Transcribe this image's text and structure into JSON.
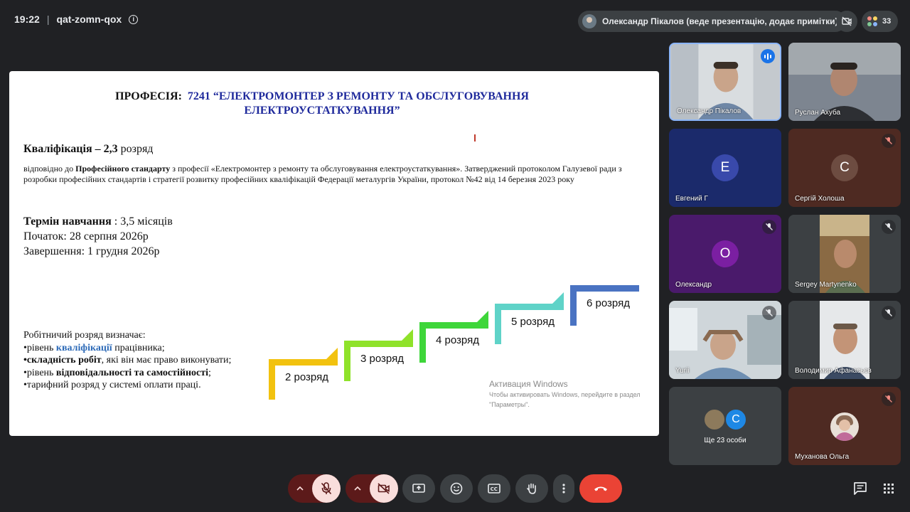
{
  "meeting": {
    "time": "19:22",
    "separator": "|",
    "code": "qat-zomn-qox",
    "presenter_status": "Олександр Пікалов (веде презентацію, додає примітки)",
    "participant_count": "33"
  },
  "slide": {
    "title_prefix": "ПРОФЕСІЯ:",
    "title_line1": "7241 “ЕЛЕКТРОМОНТЕР З РЕМОНТУ ТА ОБСЛУГОВУВАННЯ",
    "title_line2": "ЕЛЕКТРОУСТАТКУВАННЯ”",
    "qualification_bold": "Кваліфікація – 2,3",
    "qualification_rest": "  розряд",
    "description_pre": "відповідно до ",
    "description_bold": "Професійного стандарту",
    "description_post": " з професії  «Електромонтер з ремонту та обслуговування електроустаткування».  Затверджений протоколом Галузевої ради з розробки професійних стандартів і стратегії розвитку професійних кваліфікацій Федерації металургів України, протокол №42 від 14 березня 2023 року",
    "term_bold": "Термін навчання",
    "term_rest": " : 3,5  місяців",
    "start": "Початок: 28 серпня 2026р",
    "end": "Завершення:  1 грудня 2026р",
    "determines_heading": "Робітничий розряд визначає:",
    "bullet1_pre": "•рівень ",
    "bullet1_blue": "кваліфікації",
    "bullet1_post": " працівника;",
    "bullet2_bold": "•складність робіт",
    "bullet2_post": ", які він має право виконувати;",
    "bullet3_pre": "•рівень ",
    "bullet3_bold": "відповідальності та самостійності",
    "bullet3_post": ";",
    "bullet4": "•тарифний розряд у системі оплати праці.",
    "steps": [
      "2  розряд",
      "3  розряд",
      "4  розряд",
      "5  розряд",
      "6  розряд"
    ],
    "step_colors": [
      "#f2c20f",
      "#8fe22a",
      "#3ed63a",
      "#5fd3c8",
      "#4a73c2"
    ],
    "watermark_title": "Активация Windows",
    "watermark_sub1": "Чтобы активировать Windows, перейдите в раздел",
    "watermark_sub2": "\"Параметры\"."
  },
  "participants": [
    {
      "name": "Олександр Пікалов",
      "state": "speaking"
    },
    {
      "name": "Руслан Ахуба",
      "state": "video"
    },
    {
      "name": "Евгений Г",
      "initial": "Е",
      "color": "#3949ab",
      "state": "avatar"
    },
    {
      "name": "Сергій Холоша",
      "initial": "С",
      "color": "#6d4c41",
      "state": "muted"
    },
    {
      "name": "Олександр",
      "initial": "О",
      "color": "#7b1fa2",
      "state": "muted"
    },
    {
      "name": "Sergey Martynenko",
      "state": "muted"
    },
    {
      "name": "Yurii",
      "state": "muted"
    },
    {
      "name": "Володимир Афанасьєв",
      "state": "muted"
    },
    {
      "name": "Ще 23 особи",
      "initial": "С",
      "color": "#1e88e5",
      "state": "more"
    },
    {
      "name": "Муханова Ольга",
      "state": "muted"
    }
  ],
  "controls": {
    "mic": "mic-off",
    "camera": "camera-off",
    "present": "present",
    "emoji": "emoji",
    "captions": "captions",
    "raise_hand": "raise-hand",
    "more": "more",
    "end_call": "end-call",
    "chat": "chat",
    "activities": "activities",
    "danger_bg": "#5c1a1a",
    "danger_fill": "#f9dedc",
    "end_color": "#ea4335"
  }
}
